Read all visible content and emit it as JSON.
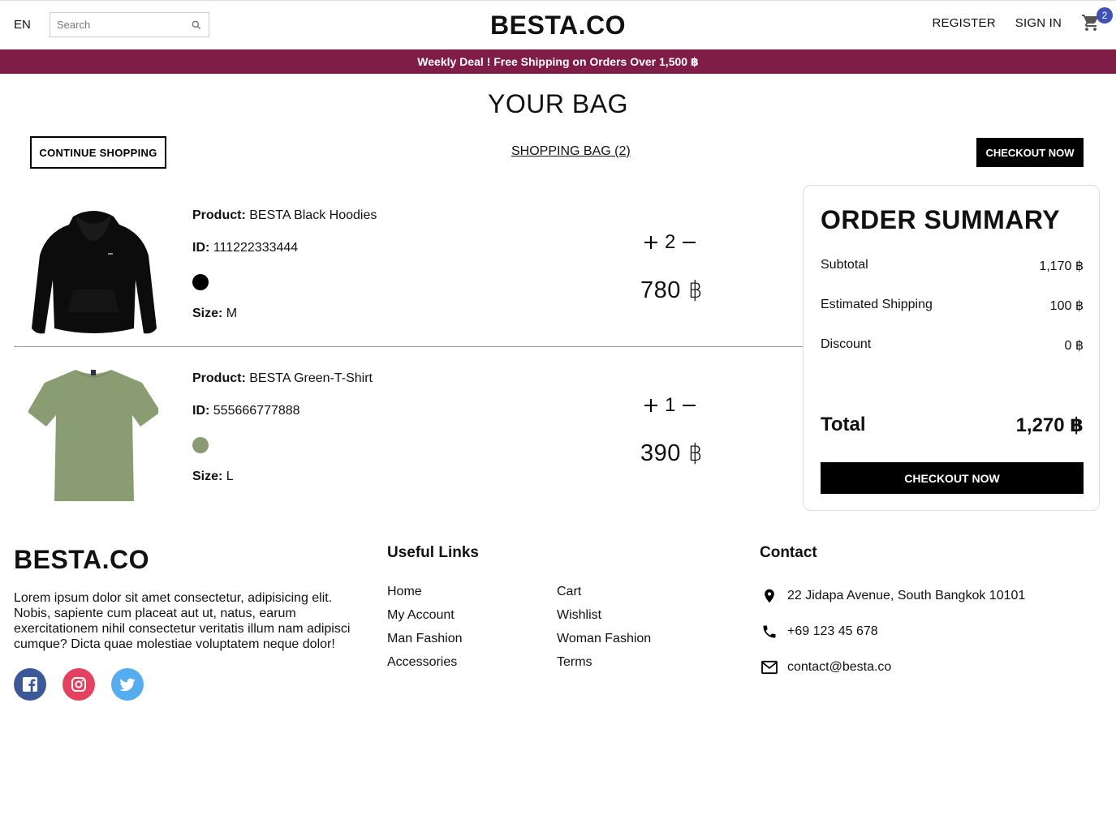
{
  "navbar": {
    "language": "EN",
    "search_placeholder": "Search",
    "logo": "BESTA.CO",
    "register": "REGISTER",
    "sign_in": "SIGN IN",
    "cart_count": "2"
  },
  "announcement": "Weekly Deal ! Free Shipping on Orders Over 1,500 ฿",
  "bag": {
    "title": "YOUR BAG",
    "continue_label": "CONTINUE SHOPPING",
    "bag_link": "SHOPPING BAG (2)",
    "checkout_label": "CHECKOUT NOW"
  },
  "labels": {
    "product": "Product:",
    "id": "ID:",
    "size": "Size:"
  },
  "products": [
    {
      "name": "BESTA Black Hoodies",
      "id": "111222333444",
      "color": "#000000",
      "size": "M",
      "quantity": "2",
      "price": "780 ฿"
    },
    {
      "name": "BESTA Green-T-Shirt",
      "id": "555666777888",
      "color": "#8a9a72",
      "size": "L",
      "quantity": "1",
      "price": "390 ฿"
    }
  ],
  "summary": {
    "title": "ORDER SUMMARY",
    "subtotal_label": "Subtotal",
    "subtotal_value": "1,170 ฿",
    "shipping_label": "Estimated Shipping",
    "shipping_value": "100 ฿",
    "discount_label": "Discount",
    "discount_value": "0 ฿",
    "total_label": "Total",
    "total_value": "1,270 ฿",
    "checkout_label": "CHECKOUT NOW"
  },
  "footer": {
    "logo": "BESTA.CO",
    "description": "Lorem ipsum dolor sit amet consectetur, adipisicing elit. Nobis, sapiente cum placeat aut ut, natus, earum exercitationem nihil consectetur veritatis illum nam adipisci cumque? Dicta quae molestiae voluptatem neque dolor!",
    "links_title": "Useful Links",
    "links": [
      "Home",
      "Cart",
      "My Account",
      "Wishlist",
      "Man Fashion",
      "Woman Fashion",
      "Accessories",
      "Terms"
    ],
    "contact_title": "Contact",
    "address": "22 Jidapa Avenue, South Bangkok 10101",
    "phone": "+69 123 45 678",
    "email": "contact@besta.co"
  },
  "colors": {
    "announcement_bg": "#7f1d47",
    "badge": "#3f51b5",
    "facebook": "#3b5999",
    "instagram": "#e4405f",
    "twitter": "#55acee"
  }
}
